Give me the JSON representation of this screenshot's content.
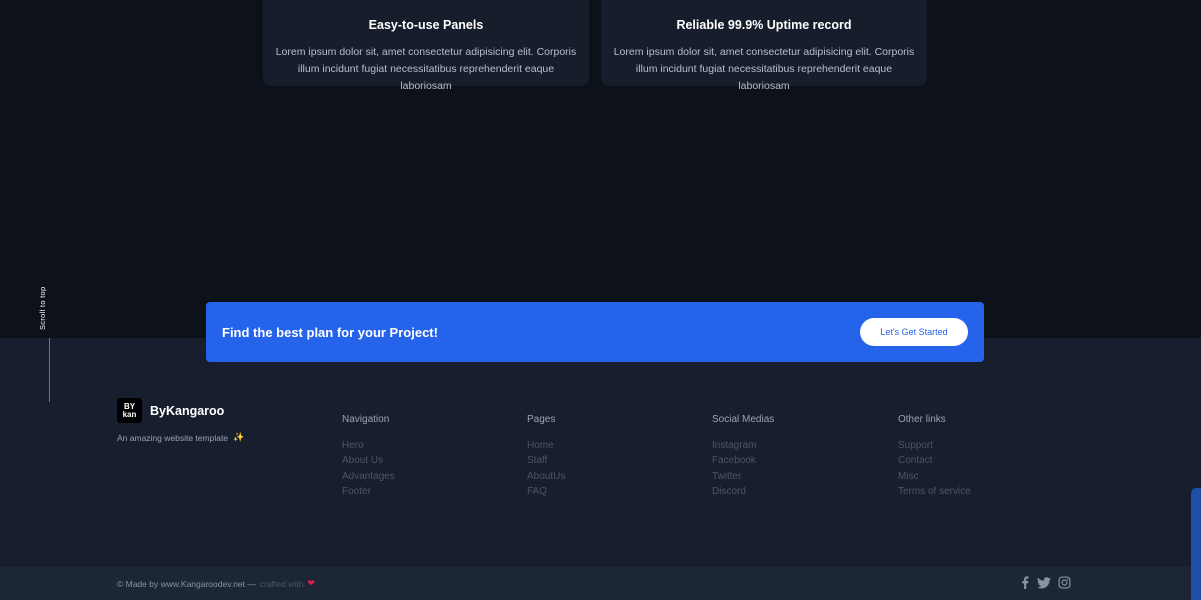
{
  "cards": [
    {
      "title": "Easy-to-use Panels",
      "text": "Lorem ipsum dolor sit, amet consectetur adipisicing elit. Corporis illum incidunt fugiat necessitatibus reprehenderit eaque laboriosam"
    },
    {
      "title": "Reliable 99.9% Uptime record",
      "text": "Lorem ipsum dolor sit, amet consectetur adipisicing elit. Corporis illum incidunt fugiat necessitatibus reprehenderit eaque laboriosam"
    }
  ],
  "scroll_top": {
    "label": "Scroll to top"
  },
  "cta": {
    "title": "Find the best plan for your Project!",
    "button_label": "Let's Get Started"
  },
  "brand": {
    "logo_line1": "BY",
    "logo_line2": "kan",
    "name": "ByKangaroo",
    "tagline": "An amazing website template",
    "tagline_icon": "sparkle-icon"
  },
  "footer_columns": [
    {
      "heading": "Navigation",
      "links": [
        "Hero",
        "About Us",
        "Advantages",
        "Footer"
      ]
    },
    {
      "heading": "Pages",
      "links": [
        "Home",
        "Staff",
        "AboutUs",
        "FAQ"
      ]
    },
    {
      "heading": "Social Medias",
      "links": [
        "Instagram",
        "Facebook",
        "Twitter",
        "Discord"
      ]
    },
    {
      "heading": "Other links",
      "links": [
        "Support",
        "Contact",
        "Misc",
        "Terms of service"
      ]
    }
  ],
  "bottom_bar": {
    "copyright": "© Made by www.Kangaroodev.net —",
    "crafted": "crafted with",
    "heart_icon": "heart-icon",
    "social_icons": [
      "facebook-icon",
      "twitter-icon",
      "instagram-icon"
    ]
  },
  "colors": {
    "background": "#0d111a",
    "card": "#161d2b",
    "footer": "#171f2e",
    "bottom_bar": "#1d2636",
    "accent": "#2563eb"
  }
}
